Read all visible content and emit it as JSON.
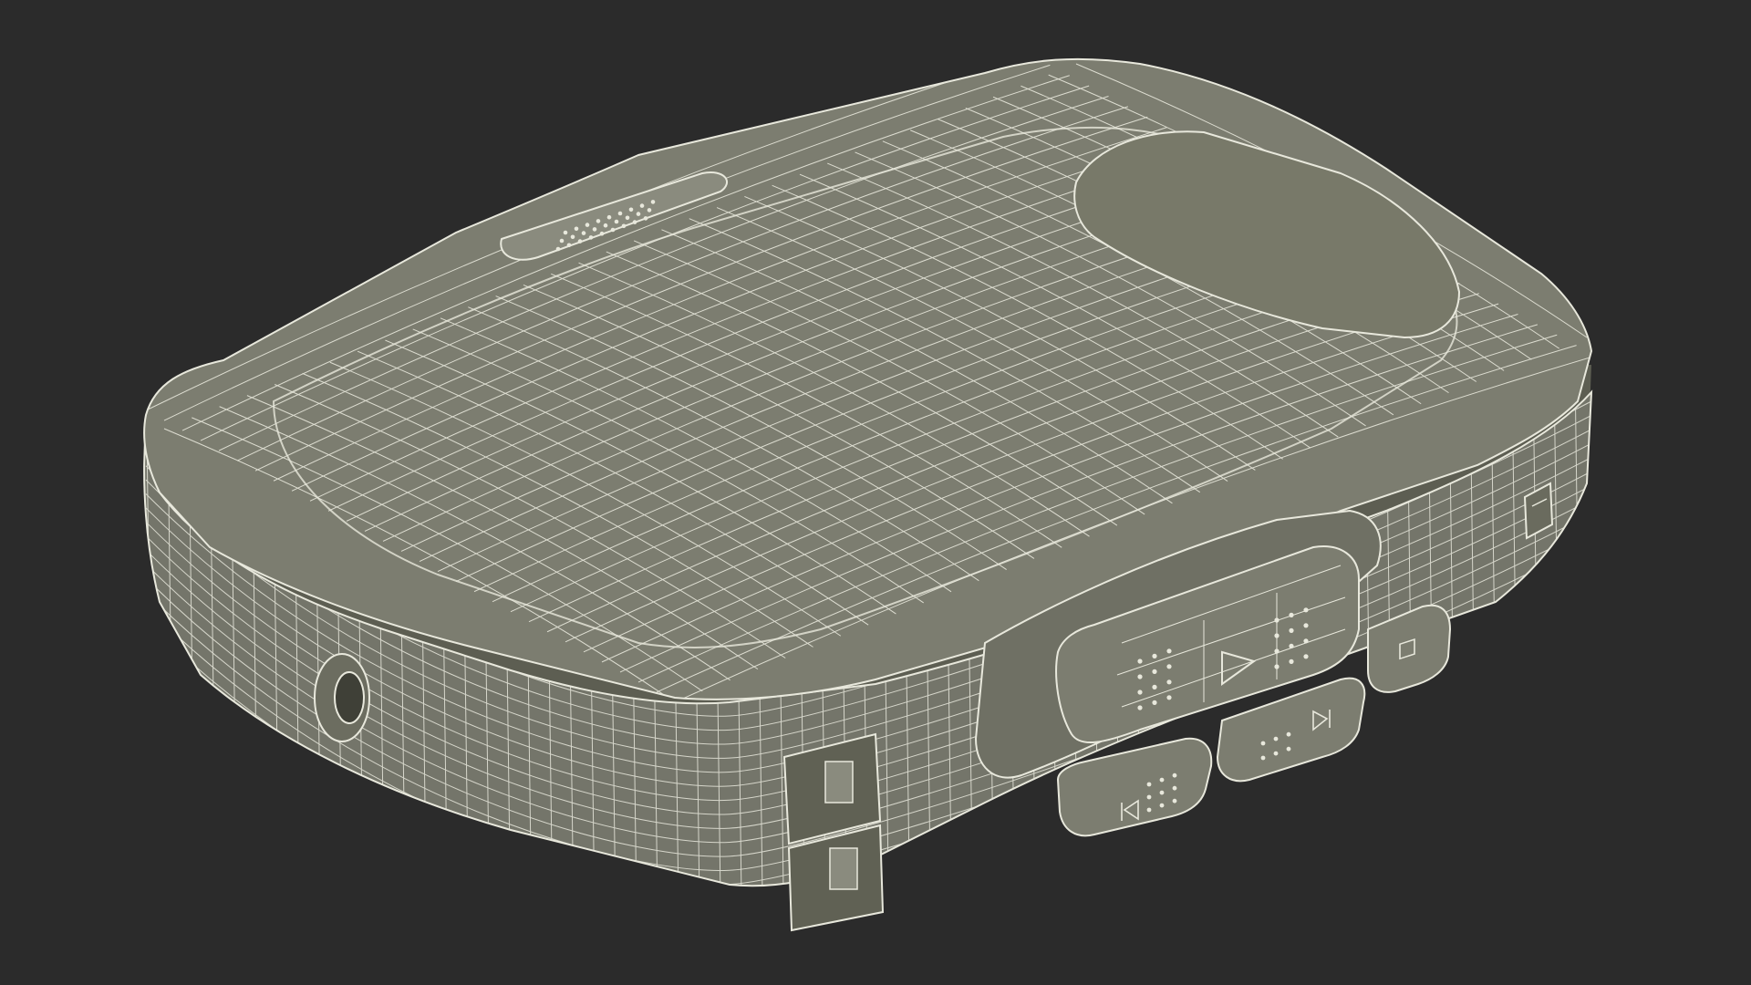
{
  "scene": {
    "subject": "cassette-player-wireframe",
    "colors": {
      "background": "#2b2b2b",
      "surface": "#7c7d70",
      "surface_light": "#8a8b7e",
      "surface_dark": "#676859",
      "wire": "#e8e8dc",
      "shadow": "#4f5046"
    },
    "buttons": [
      {
        "id": "play",
        "icon": "play-icon"
      },
      {
        "id": "fast-forward",
        "icon": "fast-forward-icon"
      },
      {
        "id": "rewind",
        "icon": "rewind-icon"
      },
      {
        "id": "stop",
        "icon": "stop-icon"
      },
      {
        "id": "volume-slider",
        "icon": "slider-icon"
      }
    ]
  }
}
